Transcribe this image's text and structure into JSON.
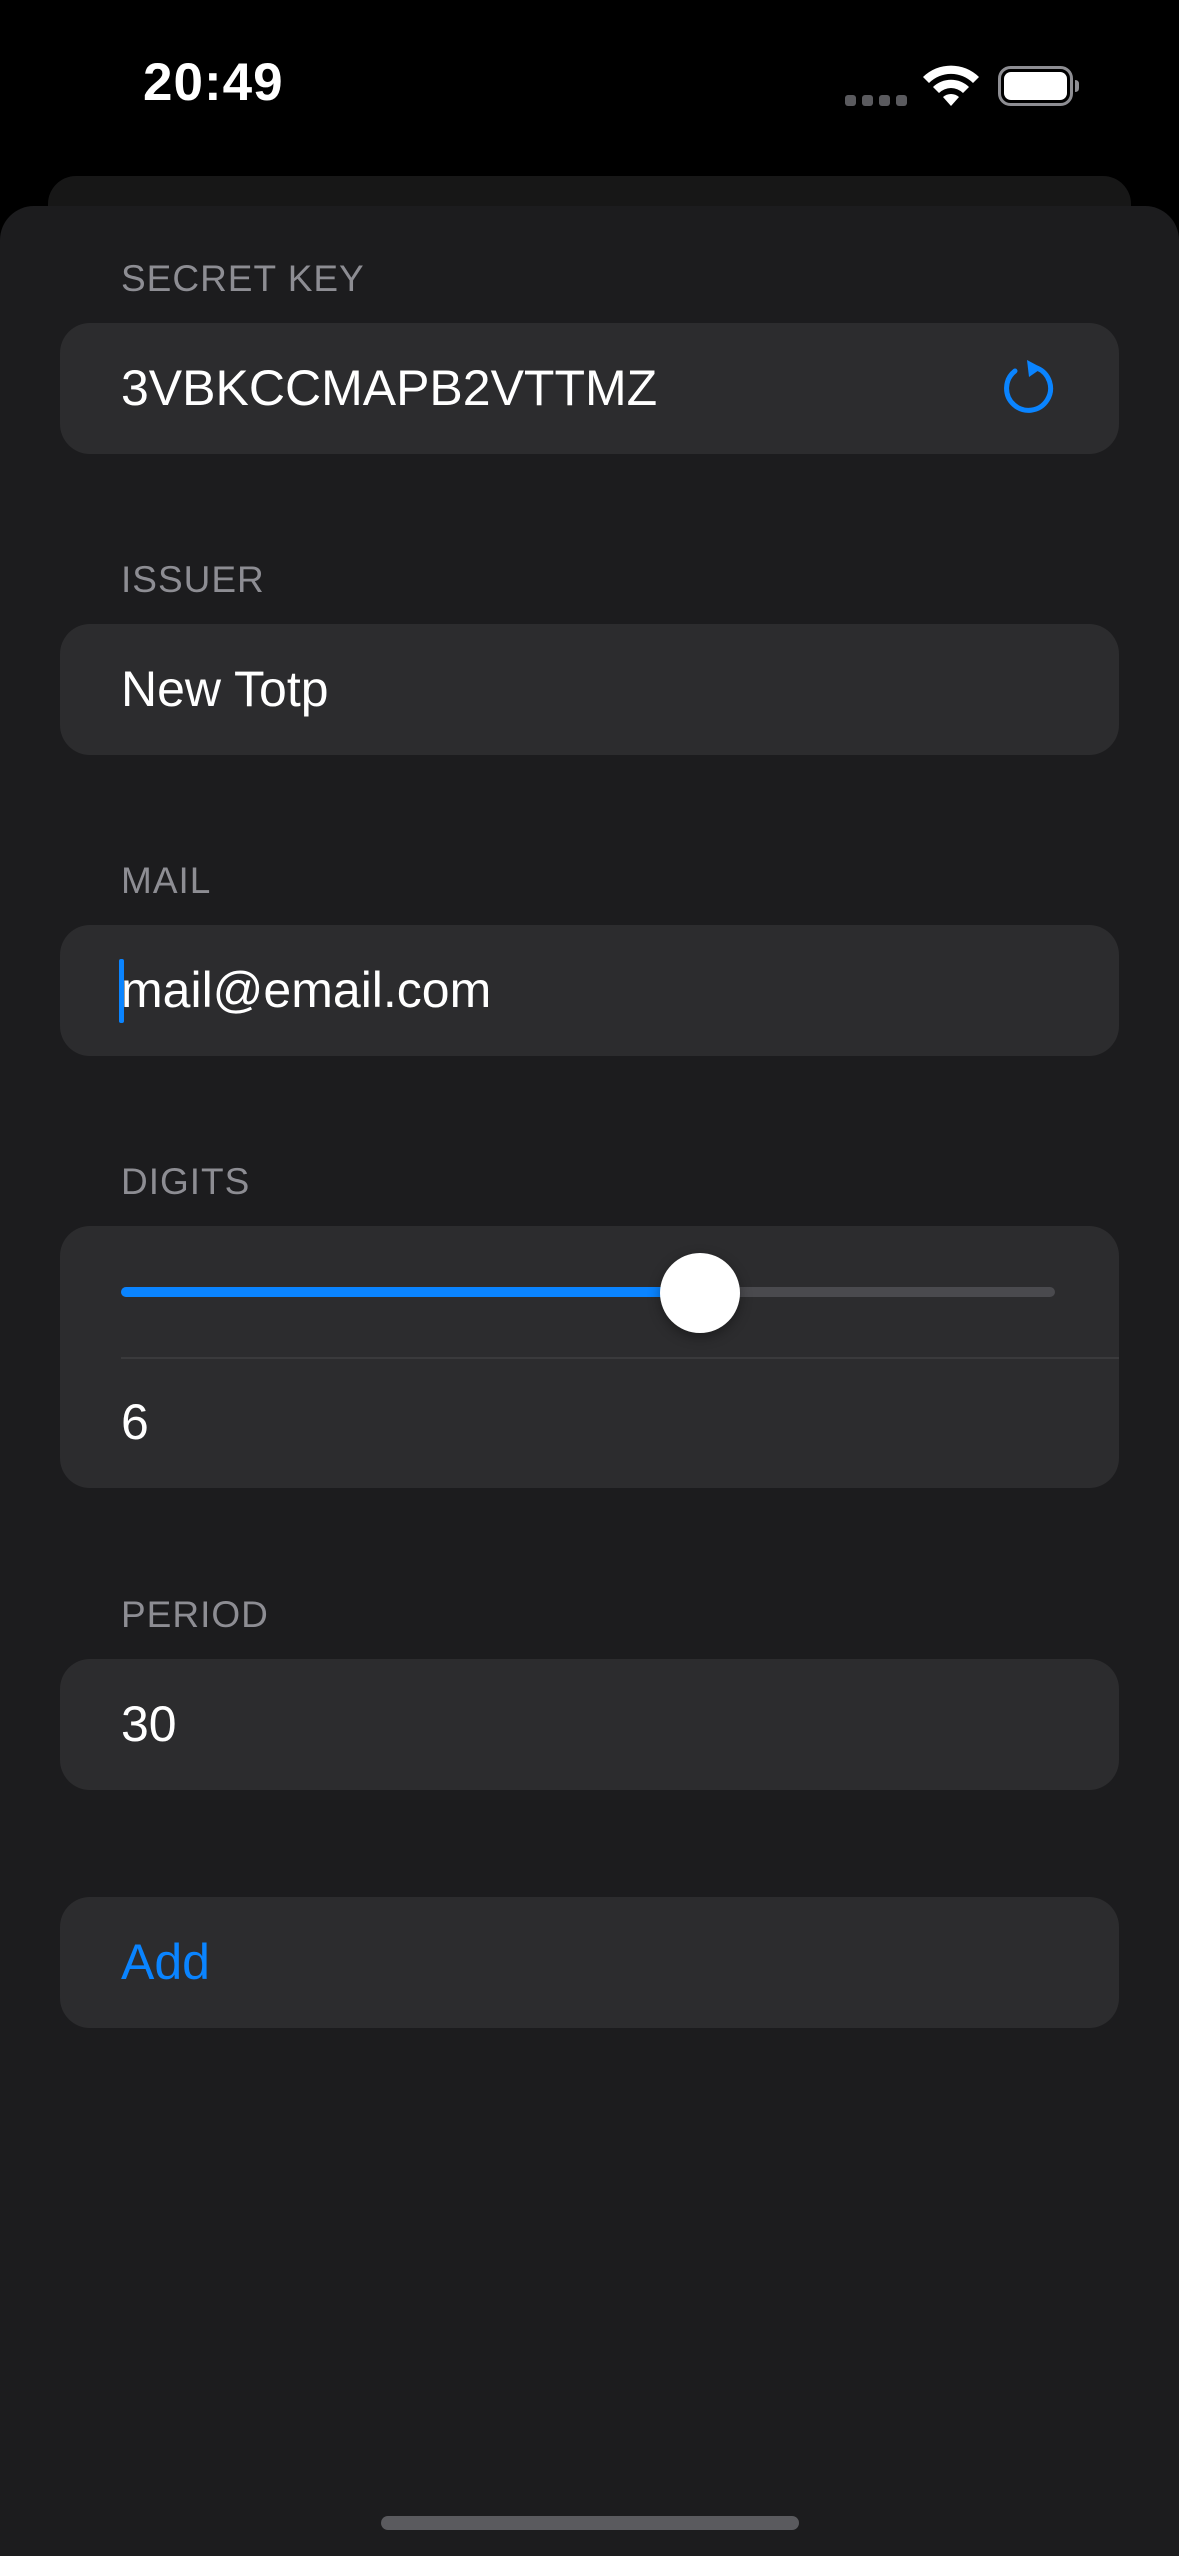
{
  "status_bar": {
    "time": "20:49"
  },
  "form": {
    "secret_key": {
      "label": "SECRET KEY",
      "value": "3VBKCCMAPB2VTTMZ",
      "refresh_icon": "refresh-icon"
    },
    "issuer": {
      "label": "ISSUER",
      "value": "New Totp"
    },
    "mail": {
      "label": "MAIL",
      "value": "mail@email.com"
    },
    "digits": {
      "label": "DIGITS",
      "value": "6",
      "slider_fraction": 0.62
    },
    "period": {
      "label": "PERIOD",
      "value": "30"
    },
    "add_button": {
      "label": "Add"
    }
  },
  "colors": {
    "accent": "#0a84ff",
    "background": "#1c1c1e",
    "field": "#2c2c2e",
    "label": "#8d8d93"
  }
}
